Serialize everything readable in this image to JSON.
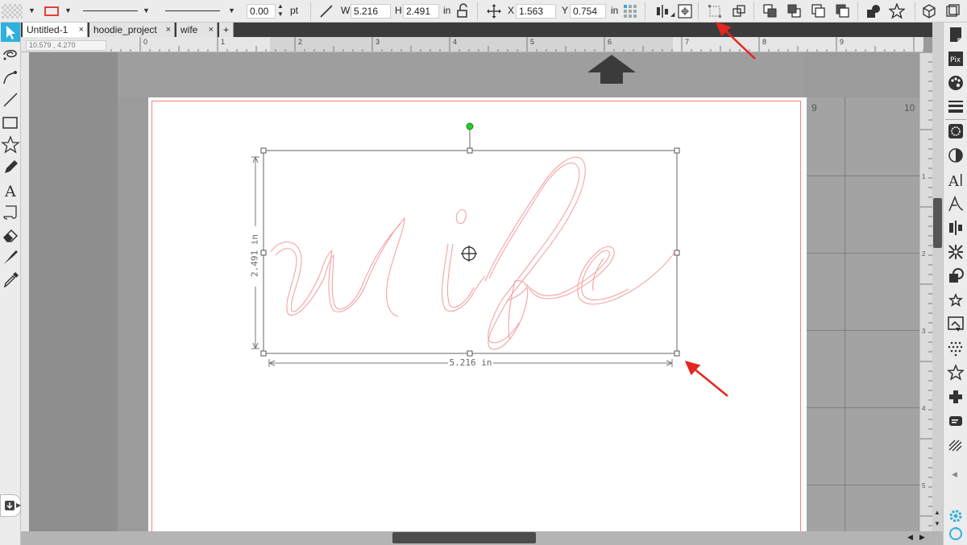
{
  "toolbar": {
    "line_weight_value": "0.00",
    "line_weight_unit": "pt",
    "w_label": "W",
    "w_value": "5.216",
    "h_label": "H",
    "h_value": "2.491",
    "size_unit": "in",
    "x_label": "X",
    "x_value": "1.563",
    "y_label": "Y",
    "y_value": "0.754",
    "pos_unit": "in"
  },
  "tabs": [
    {
      "label": "Untitled-1",
      "active": true
    },
    {
      "label": "hoodie_project",
      "active": false
    },
    {
      "label": "wife",
      "active": false
    }
  ],
  "tab_add_label": "+",
  "tab_close_glyph": "×",
  "ruler": {
    "coord_readout": "10.579 , 4.270",
    "h_ticks": [
      "0",
      "1",
      "2",
      "3",
      "4",
      "5",
      "6",
      "7",
      "8",
      "9"
    ],
    "v_ticks": [
      "1",
      "2",
      "3",
      "4",
      "5"
    ],
    "grid_labels": [
      "9",
      "10"
    ]
  },
  "selection": {
    "text": "wife",
    "width_label": "5.216 in",
    "height_label": "2.491 in"
  },
  "colors": {
    "cut_line": "#f4a3a3",
    "page_border": "#f08080",
    "annotation_arrow": "#e3261f",
    "active_tool": "#2fb0de",
    "rotate_handle": "#26c926"
  },
  "icons": {
    "left": [
      "select-arrow-icon",
      "knife-lasso-icon",
      "bezier-curve-icon",
      "line-icon",
      "rectangle-icon",
      "star-polygon-icon",
      "pencil-icon",
      "text-icon",
      "text-on-path-icon",
      "eraser-icon",
      "knife-icon",
      "eyedropper-icon"
    ],
    "right": [
      "page-setup-icon",
      "pixscan-icon",
      "fill-palette-icon",
      "line-style-icon",
      "image-effects-icon",
      "transparency-icon",
      "text-style-icon",
      "font-icon",
      "align-icon",
      "replicate-icon",
      "modify-icon",
      "offset-icon",
      "trace-icon",
      "cut-settings-icon",
      "star-library-icon",
      "weld-icon",
      "sketch-icon",
      "settings-icon"
    ]
  }
}
